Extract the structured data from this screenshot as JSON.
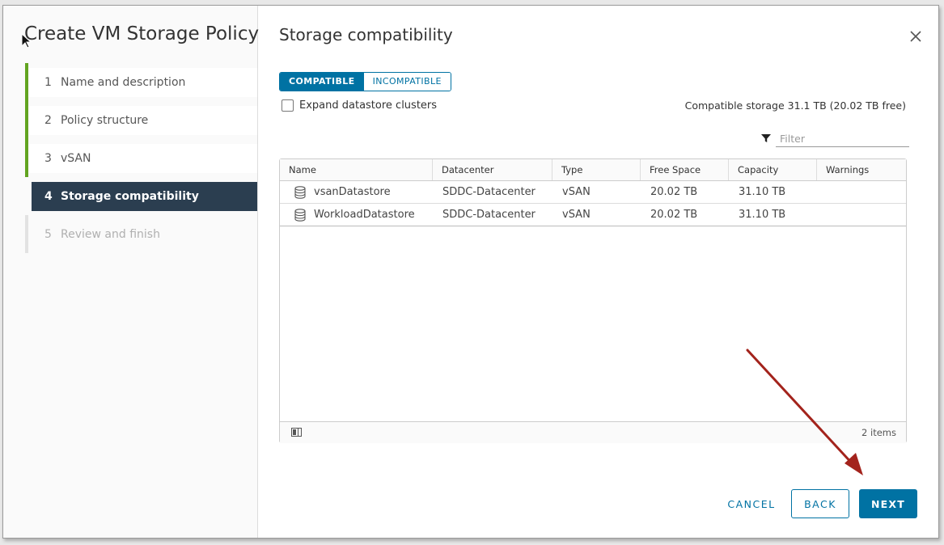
{
  "wizard": {
    "title": "Create VM Storage Policy",
    "steps": [
      {
        "num": "1",
        "label": "Name and description",
        "state": "done"
      },
      {
        "num": "2",
        "label": "Policy structure",
        "state": "done"
      },
      {
        "num": "3",
        "label": "vSAN",
        "state": "done"
      },
      {
        "num": "4",
        "label": "Storage compatibility",
        "state": "current"
      },
      {
        "num": "5",
        "label": "Review and finish",
        "state": "future"
      }
    ]
  },
  "main": {
    "title": "Storage compatibility",
    "tabs": {
      "compatible": "COMPATIBLE",
      "incompatible": "INCOMPATIBLE"
    },
    "expand_checkbox_label": "Expand datastore clusters",
    "compatible_storage": "Compatible storage 31.1 TB (20.02 TB free)",
    "filter_placeholder": "Filter"
  },
  "grid": {
    "columns": [
      "Name",
      "Datacenter",
      "Type",
      "Free Space",
      "Capacity",
      "Warnings"
    ],
    "rows": [
      {
        "name": "vsanDatastore",
        "datacenter": "SDDC-Datacenter",
        "type": "vSAN",
        "free_space": "20.02 TB",
        "capacity": "31.10 TB",
        "warnings": ""
      },
      {
        "name": "WorkloadDatastore",
        "datacenter": "SDDC-Datacenter",
        "type": "vSAN",
        "free_space": "20.02 TB",
        "capacity": "31.10 TB",
        "warnings": ""
      }
    ],
    "footer_count": "2 items"
  },
  "buttons": {
    "cancel": "CANCEL",
    "back": "BACK",
    "next": "NEXT"
  },
  "colors": {
    "accent": "#0072a3",
    "step_done": "#62a420",
    "step_current_bg": "#2b3e50",
    "annotation_arrow": "#a3231c"
  },
  "icons": {
    "close": "close-icon",
    "filter": "filter-icon",
    "datastore": "datastore-icon",
    "column_toggle": "column-toggle-icon"
  }
}
